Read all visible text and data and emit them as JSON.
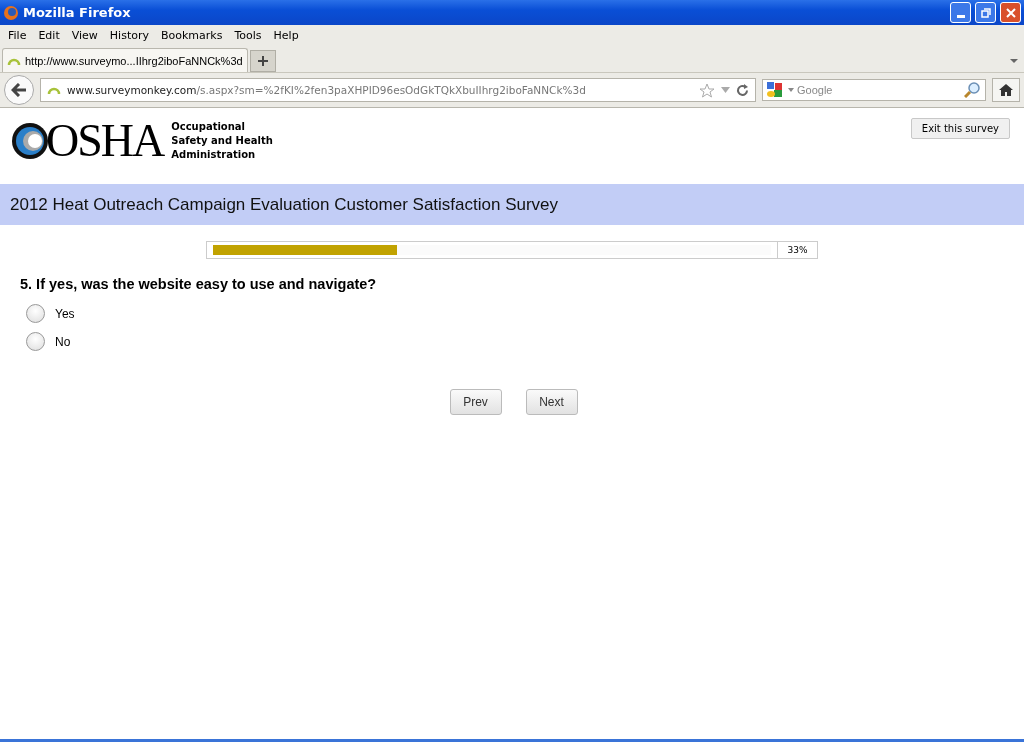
{
  "window": {
    "title": "Mozilla Firefox"
  },
  "menu": [
    "File",
    "Edit",
    "View",
    "History",
    "Bookmarks",
    "Tools",
    "Help"
  ],
  "tabs": [
    {
      "label": "http://www.surveymo...IIhrg2iboFaNNCk%3d",
      "selected": true
    }
  ],
  "address_bar": {
    "host": "www.surveymonkey.com",
    "path": "/s.aspx?sm=%2fKI%2fen3paXHPID96esOdGkTQkXbuIIhrg2iboFaNNCk%3d"
  },
  "search": {
    "placeholder": "Google"
  },
  "header": {
    "logo": "OSHA",
    "agency": [
      "Occupational",
      "Safety and Health",
      "Administration"
    ],
    "exit_button": "Exit this survey"
  },
  "survey_title": "2012 Heat Outreach Campaign Evaluation Customer Satisfaction Survey",
  "progress": {
    "level": 0.33,
    "reading": "33%"
  },
  "question": {
    "text": "5. If yes, was the website easy to use and navigate?",
    "options": [
      {
        "label": "Yes",
        "selected": false
      },
      {
        "label": "No",
        "selected": false
      }
    ]
  },
  "buttons": [
    "Prev",
    "Next"
  ]
}
